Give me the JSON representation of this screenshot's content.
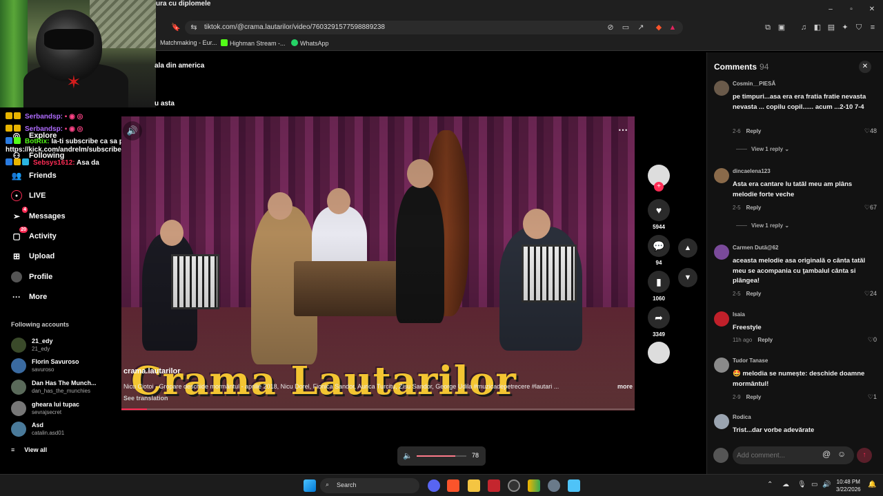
{
  "browser": {
    "tab_title": "ura cu diplomele",
    "url": "tiktok.com/@crama.lautarilor/video/7603291577598889238",
    "bookmarks": [
      "Matchmaking - Eur...",
      "Highman Stream -...",
      "WhatsApp"
    ],
    "window_controls": [
      "–",
      "▫",
      "✕"
    ]
  },
  "stream_overlay": {
    "chat": [
      {
        "user": "Serbandsp:",
        "message": ""
      },
      {
        "user": "Serbandsp:",
        "message": ""
      },
      {
        "user": "BotRix:",
        "message": "Ia-ti subscribe ca sa pot demisiona !"
      },
      {
        "user": "",
        "message": "https://kick.com/andrelm/subscribe"
      },
      {
        "user": "Sebsys1612:",
        "message": "Asa da"
      }
    ],
    "text_lines": [
      "ala din america",
      "u asta"
    ]
  },
  "sidebar": {
    "items": [
      {
        "label": "Explore",
        "icon": "compass-icon"
      },
      {
        "label": "Following",
        "icon": "user-plus-icon"
      },
      {
        "label": "Friends",
        "icon": "friends-icon"
      },
      {
        "label": "LIVE",
        "icon": "live-icon"
      },
      {
        "label": "Messages",
        "icon": "send-icon",
        "badge": "4"
      },
      {
        "label": "Activity",
        "icon": "bell-icon",
        "badge": "20"
      },
      {
        "label": "Upload",
        "icon": "plus-square-icon"
      },
      {
        "label": "Profile",
        "icon": "avatar-icon"
      },
      {
        "label": "More",
        "icon": "dots-icon"
      }
    ],
    "following_header": "Following accounts",
    "accounts": [
      {
        "name": "21_edy",
        "handle": "21_edy"
      },
      {
        "name": "Florin Savuroso",
        "handle": "savuroso"
      },
      {
        "name": "Dan Has The Munch...",
        "handle": "dan_has_the_munchies"
      },
      {
        "name": "gheara lui tupac",
        "handle": "sevrajsecret"
      },
      {
        "name": "Asd",
        "handle": "catalin.asd01"
      }
    ],
    "view_all": "View all"
  },
  "video": {
    "title_overlay": "Crama Lautarilor",
    "author": "crama.lautarilor",
    "description": "Nicu Ciotoi  - Gropare deschide mormântul  - aprilie 2018, Nicu Dorel,  Fionica Sandor,  Aurica Turcitu, Zisu Sandor, George Udila #muzicadepetrecere #lautari ...",
    "more": "more",
    "translate": "See translation",
    "progress_fraction": 0.05
  },
  "actions": {
    "likes": "5944",
    "comments": "94",
    "saves": "1060",
    "shares": "3349"
  },
  "volume": {
    "value": "78",
    "fraction": 0.78
  },
  "comments_panel": {
    "title": "Comments",
    "count": "94",
    "input_placeholder": "Add comment...",
    "items": [
      {
        "user": "Cosmin__PIESĂ",
        "text": "pe timpuri...asa era era fratia fratie nevasta nevasta ... copilu copil...... acum ...2-10 7-4",
        "date": "2-6",
        "reply": "Reply",
        "likes": "48",
        "view_replies": "View 1 reply"
      },
      {
        "user": "dincaelena123",
        "text": "Asta era cantare lu tatăl meu am plâns melodie forte veche",
        "date": "2-5",
        "reply": "Reply",
        "likes": "67",
        "view_replies": "View 1 reply"
      },
      {
        "user": "Carmen Dută@62",
        "text": "aceasta melodie asa originală o cânta tatăl meu se acompania cu ţambalul cânta si plângea!",
        "date": "2-5",
        "reply": "Reply",
        "likes": "24"
      },
      {
        "user": "Isaia",
        "text": "Freestyle",
        "date": "11h ago",
        "reply": "Reply",
        "likes": "0"
      },
      {
        "user": "Tudor Tanase",
        "text": "🤩 melodia se numește: deschide doamne mormântul!",
        "date": "2-9",
        "reply": "Reply",
        "likes": "1"
      },
      {
        "user": "Rodica",
        "text": "Trist...dar vorbe adevărate"
      }
    ]
  },
  "taskbar": {
    "search": "Search",
    "time": "10:48 PM",
    "date": "3/22/2026"
  },
  "colors": {
    "accent": "#fe2c55",
    "title_gold": "#f3c532",
    "panel": "#121212"
  }
}
